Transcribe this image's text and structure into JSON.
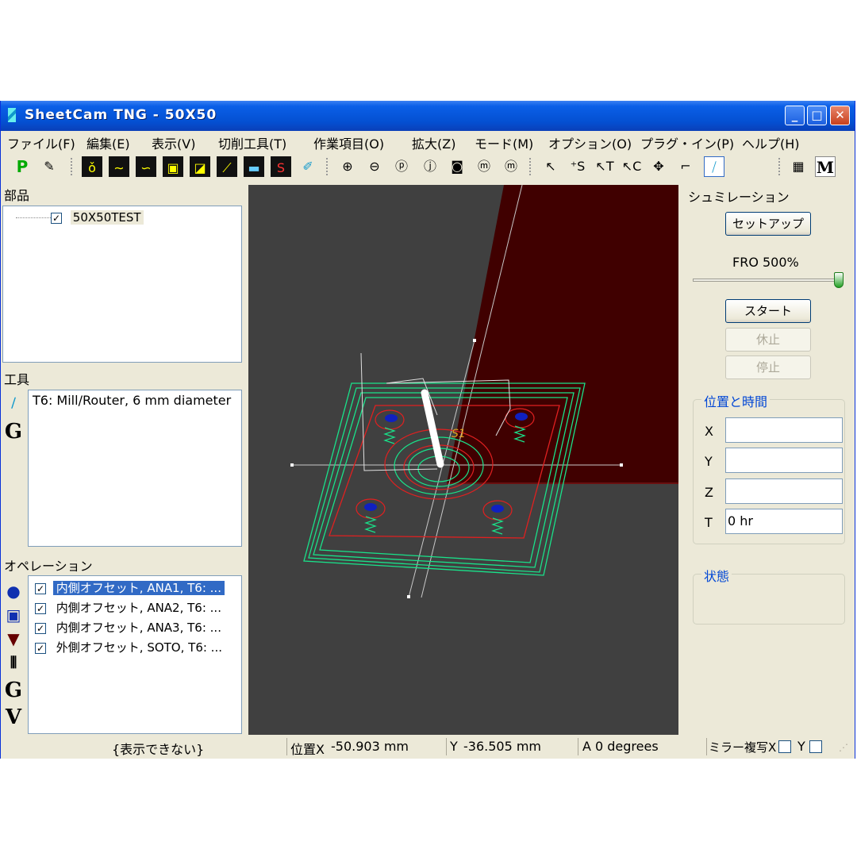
{
  "window": {
    "title": "SheetCam TNG - 50X50",
    "controls": {
      "minimize": "_",
      "maximize": "□",
      "close": "✕"
    }
  },
  "menu": [
    "ファイル(F)",
    "編集(E)",
    "表示(V)",
    "切削工具(T)",
    "作業項目(O)",
    "拡大(Z)",
    "モード(M)",
    "オプション(O)",
    "プラグ・イン(P)",
    "ヘルプ(H)"
  ],
  "toolbar": {
    "p_label": "P",
    "m_label": "M",
    "icons": [
      "p-icon",
      "edit-icon",
      "contour-icon",
      "wave-icon",
      "wave2-icon",
      "square-icon",
      "square2-icon",
      "drill-icon",
      "display-icon",
      "start-icon",
      "pen-icon",
      "zoom-in-icon",
      "zoom-out-icon",
      "zoom-p-icon",
      "zoom-j-icon",
      "zoom-window-icon",
      "zoom-m-icon",
      "zoom-mc-icon",
      "select-icon",
      "select-start-icon",
      "select-t-icon",
      "select-c-icon",
      "move-icon",
      "rotate-icon",
      "simulate-icon",
      "calculator-icon",
      "m-icon"
    ]
  },
  "parts": {
    "header": "部品",
    "items": [
      {
        "label": "50X50TEST",
        "checked": true
      }
    ]
  },
  "tools": {
    "header": "工具",
    "side_g": "G",
    "items": [
      "T6: Mill/Router, 6 mm diameter"
    ]
  },
  "operations": {
    "header": "オペレーション",
    "side_g": "G",
    "side_v": "V",
    "items": [
      {
        "label": "内側オフセット, ANA1, T6: ...",
        "checked": true,
        "selected": true
      },
      {
        "label": "内側オフセット, ANA2, T6: ...",
        "checked": true,
        "selected": false
      },
      {
        "label": "内側オフセット, ANA3, T6: ...",
        "checked": true,
        "selected": false
      },
      {
        "label": "外側オフセット, SOTO, T6: ...",
        "checked": true,
        "selected": false
      }
    ]
  },
  "viewport": {
    "start_label": "S1",
    "colors": {
      "background": "#404040",
      "material": "#400000",
      "toolpath": "#19e28a",
      "geometry": "#e02020"
    }
  },
  "simulation": {
    "header": "シュミレーション",
    "setup_label": "セットアップ",
    "fro_label": "FRO 500%",
    "fro_level": 1.0,
    "start_label": "スタート",
    "pause_label": "休止",
    "stop_label": "停止",
    "position_group": "位置と時間",
    "fields": [
      {
        "label": "X",
        "value": ""
      },
      {
        "label": "Y",
        "value": ""
      },
      {
        "label": "Z",
        "value": ""
      },
      {
        "label": "T",
        "value": "0 hr"
      }
    ],
    "status_group": "状態"
  },
  "statusbar": {
    "message": "{表示できない}",
    "pos_label": "位置X",
    "x_value": "-50.903 mm",
    "y_label": "Y",
    "y_value": "-36.505 mm",
    "a_label": "A",
    "a_value": "0 degrees",
    "mirror_label": "ミラー複写X",
    "mirror_y": "Y"
  }
}
